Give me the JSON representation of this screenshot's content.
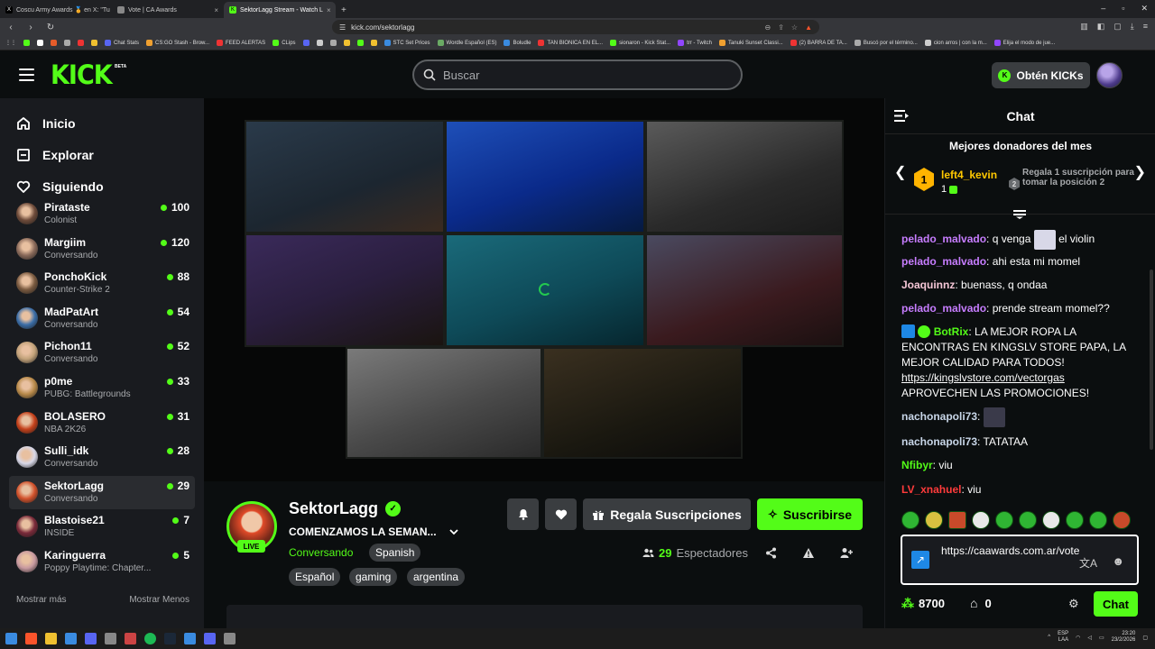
{
  "browser": {
    "tabs": [
      {
        "label": "Coscu Army Awards 🏅 en X: \"Tu po",
        "active": false
      },
      {
        "label": "Vote | CA Awards",
        "active": false
      },
      {
        "label": "SektorLagg Stream - Watch L",
        "active": true
      }
    ],
    "url": "kick.com/sektorlagg",
    "bookmarks": [
      "Chat Stats",
      "CS:GO Stash - Brow...",
      "FEED ALERTAS",
      "CLips",
      "STC Set Prices",
      "Wordle Español (ES)",
      "Boludle",
      "TAN BIONICA EN EL...",
      "sionaron - Kick Stat...",
      "trr - Twitch",
      "Tanuki Sunset Classi...",
      "(2) BARRA DE TA...",
      "Buscó por el término...",
      "cion arros | con la m...",
      "Elija el modo de jue..."
    ]
  },
  "header": {
    "logo": "KICK",
    "logo_badge": "BETA",
    "search_placeholder": "Buscar",
    "get_kicks": "Obtén KICKs"
  },
  "sidebar": {
    "nav": [
      {
        "label": "Inicio",
        "icon": "home-icon"
      },
      {
        "label": "Explorar",
        "icon": "compass-icon"
      },
      {
        "label": "Siguiendo",
        "icon": "heart-icon"
      }
    ],
    "channels": [
      {
        "name": "Pirataste",
        "sub": "Colonist",
        "viewers": "100",
        "avatar": "#6e4b3a"
      },
      {
        "name": "Margiim",
        "sub": "Conversando",
        "viewers": "120",
        "avatar": "#8a6a5a"
      },
      {
        "name": "PonchoKick",
        "sub": "Counter-Strike 2",
        "viewers": "88",
        "avatar": "#7a5a40"
      },
      {
        "name": "MadPatArt",
        "sub": "Conversando",
        "viewers": "54",
        "avatar": "#3b6ea8"
      },
      {
        "name": "Pichon11",
        "sub": "Conversando",
        "viewers": "52",
        "avatar": "#c2a27a"
      },
      {
        "name": "p0me",
        "sub": "PUBG: Battlegrounds",
        "viewers": "33",
        "avatar": "#b88a4a"
      },
      {
        "name": "BOLASERO",
        "sub": "NBA 2K26",
        "viewers": "31",
        "avatar": "#c4401a"
      },
      {
        "name": "Sulli_idk",
        "sub": "Conversando",
        "viewers": "28",
        "avatar": "#d8d8e8"
      },
      {
        "name": "SektorLagg",
        "sub": "Conversando",
        "viewers": "29",
        "avatar": "#d2522c",
        "selected": true
      },
      {
        "name": "Blastoise21",
        "sub": "INSIDE",
        "viewers": "7",
        "avatar": "#7a2a3a"
      },
      {
        "name": "Karinguerra",
        "sub": "Poppy Playtime: Chapter...",
        "viewers": "5",
        "avatar": "#c89aa0"
      }
    ],
    "show_more": "Mostrar más",
    "show_less": "Mostrar Menos"
  },
  "stream": {
    "streamer": "SektorLagg",
    "live_label": "LIVE",
    "title": "COMENZAMOS LA SEMAN...",
    "category": "Conversando",
    "language_tag": "Spanish",
    "tags": [
      "Español",
      "gaming",
      "argentina"
    ],
    "gift_subs": "Regala Suscripciones",
    "subscribe": "Suscribirse",
    "viewers": "29",
    "viewers_label": "Espectadores"
  },
  "chat": {
    "title": "Chat",
    "donors_title": "Mejores donadores del mes",
    "top_donor": {
      "rank": "1",
      "name": "left4_kevin",
      "count": "1"
    },
    "second_rank": "2",
    "donor_tip": "Regala 1 suscripción para tomar la posición 2",
    "messages": [
      {
        "user": "pelado_malvado",
        "color": "#c77dff",
        "text": "q venga",
        "emote": true,
        "after": "el violin"
      },
      {
        "user": "pelado_malvado",
        "color": "#c77dff",
        "text": "ahi esta mi momel"
      },
      {
        "user": "Joaquinnz",
        "color": "#f5c6d6",
        "text": "buenass, q ondaa"
      },
      {
        "user": "pelado_malvado",
        "color": "#c77dff",
        "text": "prende stream momel??"
      },
      {
        "user": "BotRix",
        "color": "#53fc18",
        "text": "LA MEJOR ROPA LA ENCONTRAS EN KINGSLV STORE PAPA, LA MEJOR CALIDAD PARA TODOS!",
        "link": "https://kingslvstore.com/vectorgas",
        "after": "APROVECHEN LAS PROMOCIONES!"
      },
      {
        "user": "nachonapoli73",
        "color": "#c8d6e8",
        "text": "",
        "emote": true
      },
      {
        "user": "nachonapoli73",
        "color": "#c8d6e8",
        "text": "TATATAA"
      },
      {
        "user": "Nfibyr",
        "color": "#53fc18",
        "text": "viu"
      },
      {
        "user": "LV_xnahuel",
        "color": "#ff3b3b",
        "text": "viu"
      }
    ],
    "input_value": "https://caawards.com.ar/vote",
    "points": "8700",
    "store_count": "0",
    "send_label": "Chat"
  },
  "taskbar": {
    "lang": "ESP",
    "lang2": "LAA",
    "time": "23:20",
    "date": "23/2/2026"
  }
}
